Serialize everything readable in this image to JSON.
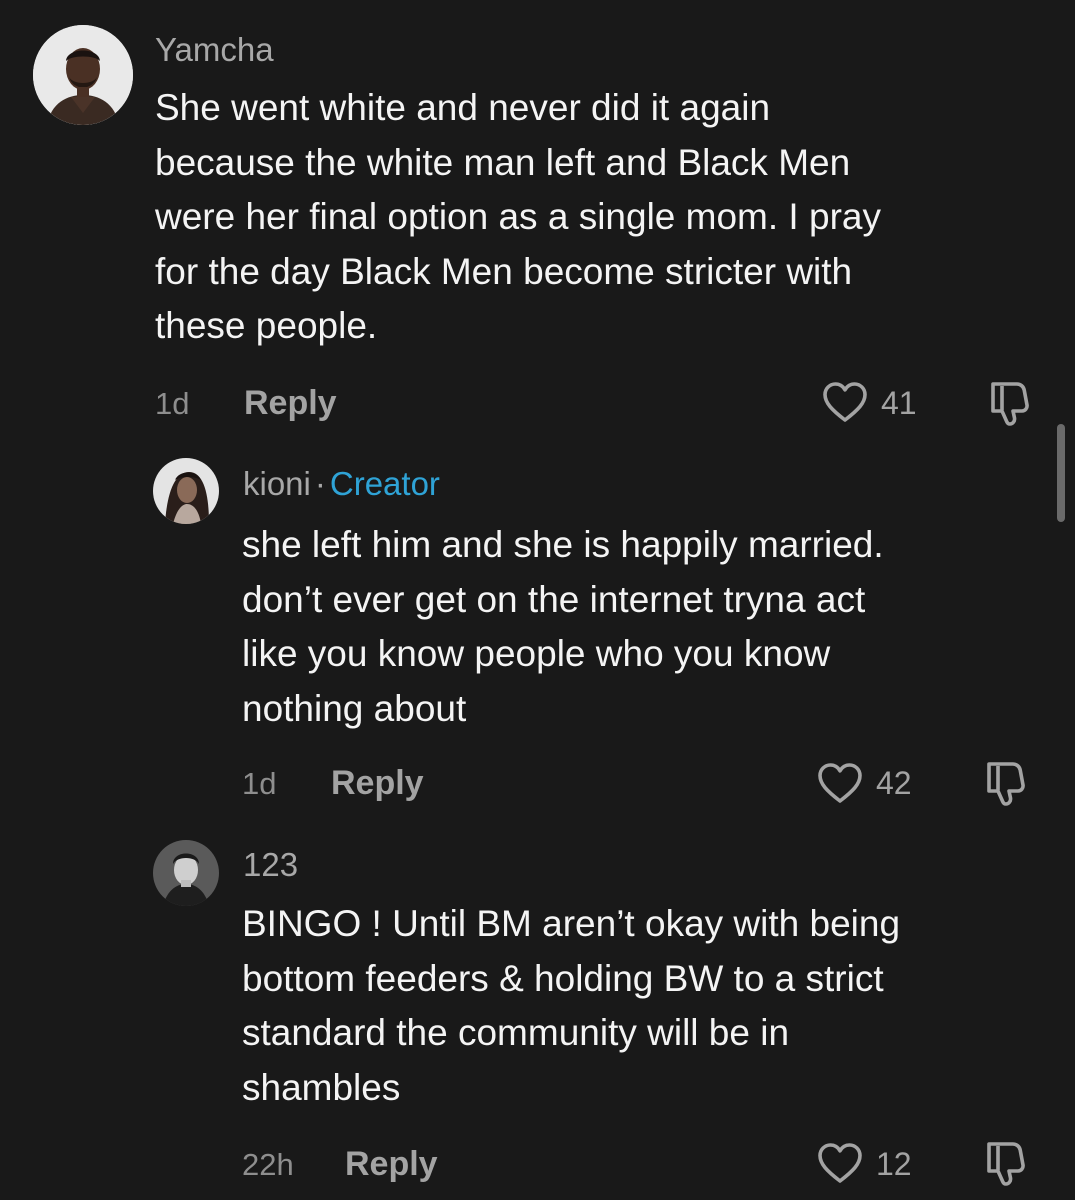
{
  "comments": [
    {
      "username": "Yamcha",
      "lines": [
        "She went white and never did it again",
        "because the white man left and Black Men",
        "were her final option as a single mom. I pray",
        "for the day Black Men become stricter with",
        "these people."
      ],
      "time": "1d",
      "reply_label": "Reply",
      "likes": "41",
      "avatar_icon": "avatar-man-portrait"
    },
    {
      "username": "kioni",
      "separator": "·",
      "badge": "Creator",
      "lines": [
        "she left him and she is happily married.",
        "don’t ever get on the internet tryna act",
        "like you know people who you know",
        "nothing about"
      ],
      "time": "1d",
      "reply_label": "Reply",
      "likes": "42",
      "avatar_icon": "avatar-woman-portrait"
    },
    {
      "username": "123",
      "lines": [
        "BINGO ! Until BM aren’t okay with being",
        "bottom feeders & holding BW to a strict",
        "standard the community will be in",
        "shambles"
      ],
      "time": "22h",
      "reply_label": "Reply",
      "likes": "12",
      "avatar_icon": "avatar-man-bw-portrait"
    }
  ],
  "colors": {
    "background": "#191919",
    "text": "#f4f4f4",
    "muted": "#a3a3a3",
    "creator_badge": "#2fa3d6"
  },
  "icons": {
    "like": "heart-outline-icon",
    "dislike": "thumbs-down-outline-icon"
  }
}
